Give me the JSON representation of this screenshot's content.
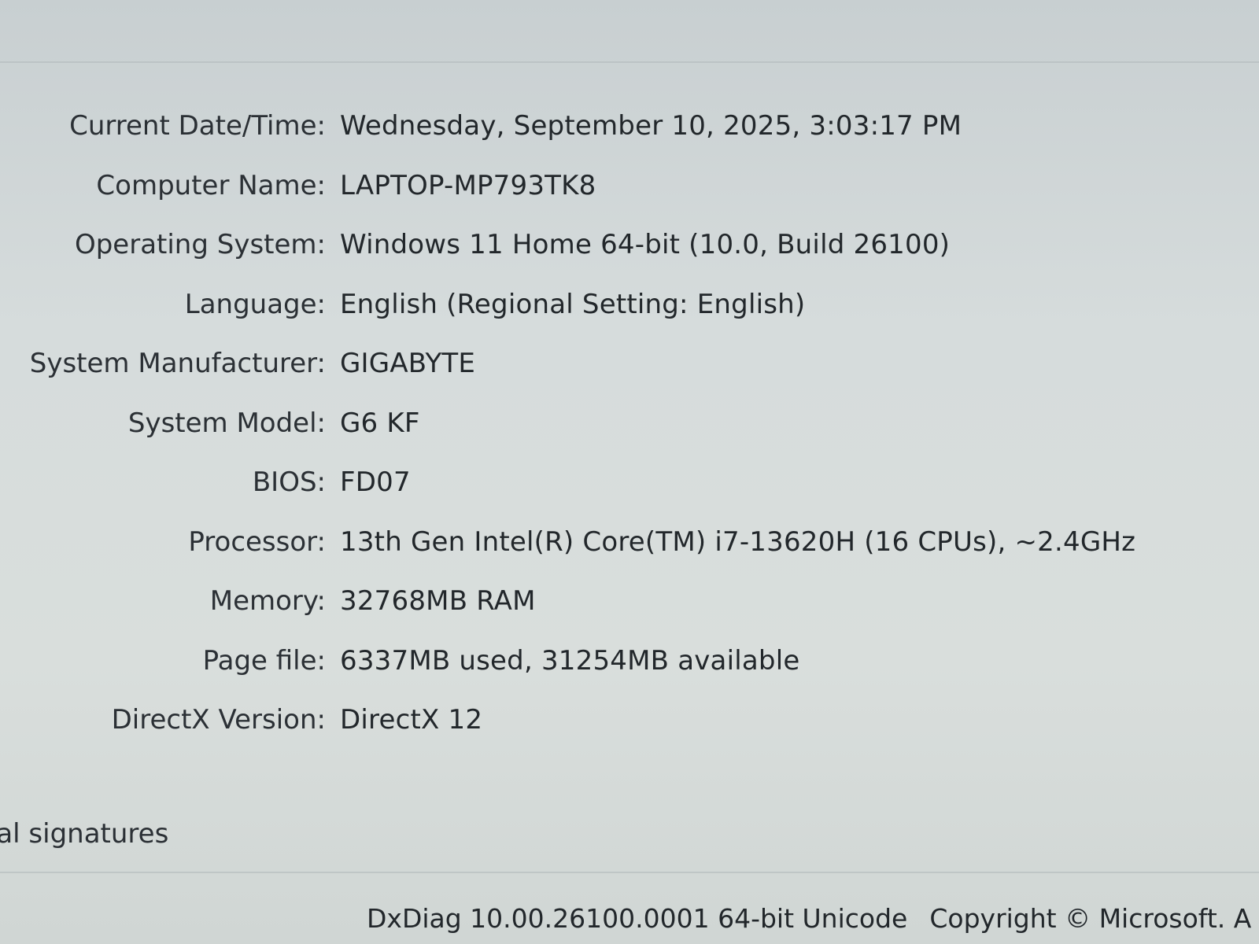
{
  "system_info": {
    "rows": [
      {
        "label": "Current Date/Time:",
        "value": "Wednesday, September 10, 2025, 3:03:17 PM"
      },
      {
        "label": "Computer Name:",
        "value": "LAPTOP-MP793TK8"
      },
      {
        "label": "Operating System:",
        "value": "Windows 11 Home 64-bit (10.0, Build 26100)"
      },
      {
        "label": "Language:",
        "value": "English (Regional Setting: English)"
      },
      {
        "label": "System Manufacturer:",
        "value": "GIGABYTE"
      },
      {
        "label": "System Model:",
        "value": "G6 KF"
      },
      {
        "label": "BIOS:",
        "value": "FD07"
      },
      {
        "label": "Processor:",
        "value": "13th Gen Intel(R) Core(TM) i7-13620H (16 CPUs), ~2.4GHz"
      },
      {
        "label": "Memory:",
        "value": "32768MB RAM"
      },
      {
        "label": "Page file:",
        "value": "6337MB used, 31254MB available"
      },
      {
        "label": "DirectX Version:",
        "value": "DirectX 12"
      }
    ]
  },
  "checkbox": {
    "label": "tal signatures"
  },
  "footer": {
    "version": "DxDiag 10.00.26100.0001 64-bit Unicode",
    "copyright": "Copyright © Microsoft. A"
  }
}
